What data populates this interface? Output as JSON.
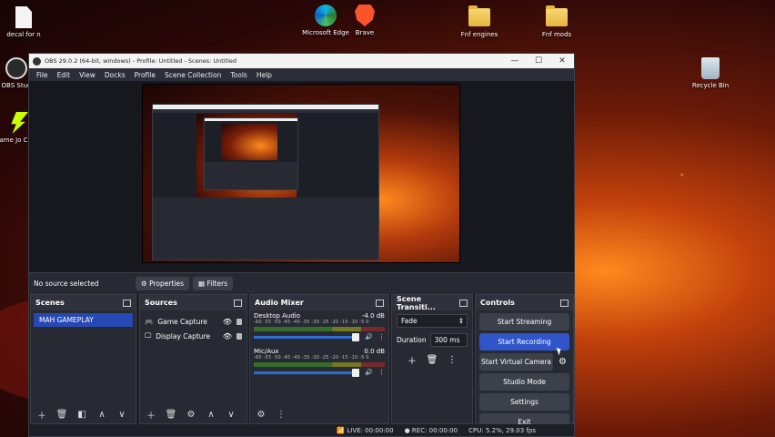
{
  "desktop": {
    "icons": [
      {
        "label": "decal for n"
      },
      {
        "label": "Microsoft Edge"
      },
      {
        "label": "Brave"
      },
      {
        "label": "Fnf engines"
      },
      {
        "label": "Fnf mods"
      },
      {
        "label": "OBS Stud"
      },
      {
        "label": "Game Jo Client"
      },
      {
        "label": "Recycle Bin"
      }
    ]
  },
  "window": {
    "title": "OBS 29.0.2 (64-bit, windows) - Profile: Untitled - Scenes: Untitled",
    "controls": {
      "minimize": "—",
      "maximize": "☐",
      "close": "✕"
    }
  },
  "menu": [
    "File",
    "Edit",
    "View",
    "Docks",
    "Profile",
    "Scene Collection",
    "Tools",
    "Help"
  ],
  "source_toolbar": {
    "status": "No source selected",
    "properties": "Properties",
    "filters": "Filters"
  },
  "scenes": {
    "title": "Scenes",
    "items": [
      "MAH GAMEPLAY"
    ]
  },
  "sources": {
    "title": "Sources",
    "items": [
      "Game Capture",
      "Display Capture"
    ]
  },
  "mixer": {
    "title": "Audio Mixer",
    "ticks": "-60 -55 -50 -45 -40 -35 -30 -25 -20 -15 -10 -5 0",
    "channels": [
      {
        "name": "Desktop Audio",
        "db": "-4.0 dB"
      },
      {
        "name": "Mic/Aux",
        "db": "0.0 dB"
      }
    ]
  },
  "transitions": {
    "title": "Scene Transiti...",
    "selected": "Fade",
    "duration_label": "Duration",
    "duration_value": "300 ms"
  },
  "controls": {
    "title": "Controls",
    "start_streaming": "Start Streaming",
    "start_recording": "Start Recording",
    "start_virtual_camera": "Start Virtual Camera",
    "studio_mode": "Studio Mode",
    "settings": "Settings",
    "exit": "Exit"
  },
  "status": {
    "live": "LIVE: 00:00:00",
    "rec": "REC: 00:00:00",
    "cpu": "CPU: 5.2%, 29.03 fps"
  },
  "colors": {
    "accent": "#2f55c8",
    "selected_scene": "#2749b6",
    "panel": "#272a33"
  }
}
